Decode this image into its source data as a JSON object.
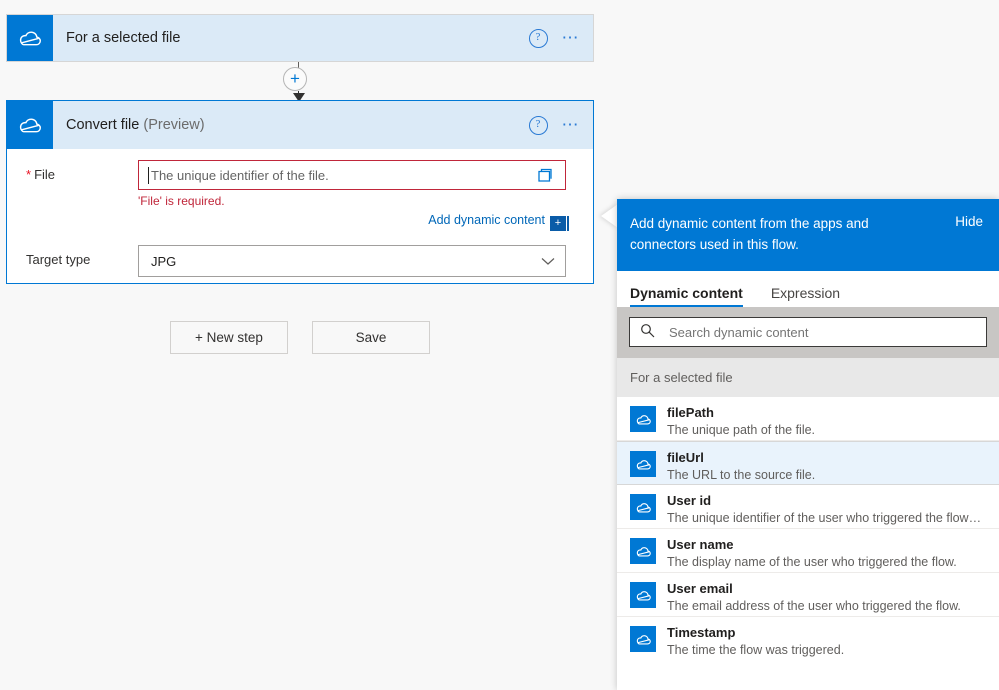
{
  "designer": {
    "trigger_card": {
      "icon": "onedrive-cloud-icon",
      "title": "For a selected file",
      "help_icon": "help-circle-icon",
      "more_icon": "more-ellipsis-icon"
    },
    "connector": {
      "add_icon": "plus-circle-icon"
    },
    "action_card": {
      "icon": "onedrive-cloud-icon",
      "title": "Convert file",
      "preview_tag": "(Preview)",
      "help_icon": "help-circle-icon",
      "more_icon": "more-ellipsis-icon",
      "file_field": {
        "required_marker": "*",
        "label": "File",
        "placeholder": "The unique identifier of the file.",
        "picker_icon": "folder-picker-icon",
        "error": "'File' is required.",
        "add_dynamic_content_label": "Add dynamic content",
        "add_dynamic_content_badge": "+"
      },
      "target_type_field": {
        "label": "Target type",
        "value": "JPG",
        "chevron_icon": "chevron-down-icon"
      }
    },
    "buttons": {
      "new_step": "+ New step",
      "save": "Save"
    }
  },
  "dynamic_panel": {
    "header_text": "Add dynamic content from the apps and connectors used in this flow.",
    "hide_label": "Hide",
    "tabs": [
      {
        "label": "Dynamic content",
        "active": true
      },
      {
        "label": "Expression",
        "active": false
      }
    ],
    "search": {
      "icon": "search-icon",
      "placeholder": "Search dynamic content",
      "value": ""
    },
    "group_label": "For a selected file",
    "items": [
      {
        "icon": "onedrive-cloud-icon",
        "name": "filePath",
        "desc": "The unique path of the file.",
        "highlighted": false
      },
      {
        "icon": "onedrive-cloud-icon",
        "name": "fileUrl",
        "desc": "The URL to the source file.",
        "highlighted": true
      },
      {
        "icon": "onedrive-cloud-icon",
        "name": "User id",
        "desc": "The unique identifier of the user who triggered the flow in A...",
        "highlighted": false
      },
      {
        "icon": "onedrive-cloud-icon",
        "name": "User name",
        "desc": "The display name of the user who triggered the flow.",
        "highlighted": false
      },
      {
        "icon": "onedrive-cloud-icon",
        "name": "User email",
        "desc": "The email address of the user who triggered the flow.",
        "highlighted": false
      },
      {
        "icon": "onedrive-cloud-icon",
        "name": "Timestamp",
        "desc": "The time the flow was triggered.",
        "highlighted": false
      }
    ]
  },
  "colors": {
    "brand_blue": "#0078d4",
    "card_header_blue": "#dbeaf7",
    "error_red": "#c0263a",
    "link_blue": "#0067b8",
    "highlight_row": "#e9f3fc"
  }
}
